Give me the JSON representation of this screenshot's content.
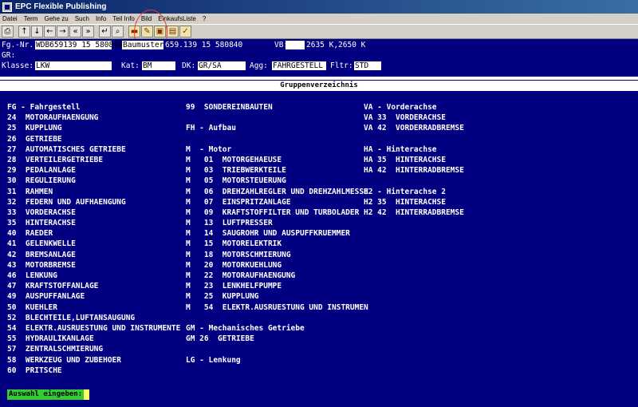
{
  "window": {
    "title": "EPC Flexible Publishing"
  },
  "menu": [
    "Datei",
    "Term",
    "Gehe zu",
    "Such",
    "Info",
    "Teil Info",
    "Bild",
    "EinkaufsListe",
    "?"
  ],
  "toolbar": {
    "icons": [
      "printer-icon",
      "arrow-up-icon",
      "arrow-down-icon",
      "arrow-left-icon",
      "arrow-right-icon",
      "double-left-icon",
      "double-right-icon",
      "return-icon",
      "search-icon",
      "car-icon",
      "tool-icon",
      "vehicle-icon",
      "truck-icon",
      "gear-icon"
    ]
  },
  "header": {
    "fg_label": "Fg.-Nr.:",
    "fg_value": "WDB659139 15 580840",
    "baumuster_label": "Baumuster:",
    "baumuster_value": "659.139 15 580840",
    "vb_label": "VB:",
    "vb_value": "2635 K,2650 K",
    "gr_label": "GR:",
    "klasse_label": "Klasse:",
    "klasse_value": "LKW",
    "kat_label": "Kat:",
    "kat_value": "BM",
    "dk_label": "DK:",
    "dk_value": "GR/SA",
    "agg_label": "Agg:",
    "agg_value": "FAHRGESTELL",
    "fltr_label": "Fltr:",
    "fltr_value": "STD"
  },
  "section_title": "Gruppenverzeichnis",
  "columns": {
    "col1": [
      "FG - Fahrgestell",
      "24  MOTORAUFHAENGUNG",
      "25  KUPPLUNG",
      "26  GETRIEBE",
      "27  AUTOMATISCHES GETRIEBE",
      "28  VERTEILERGETRIEBE",
      "29  PEDALANLAGE",
      "30  REGULIERUNG",
      "31  RAHMEN",
      "32  FEDERN UND AUFHAENGUNG",
      "33  VORDERACHSE",
      "35  HINTERACHSE",
      "40  RAEDER",
      "41  GELENKWELLE",
      "42  BREMSANLAGE",
      "43  MOTORBREMSE",
      "46  LENKUNG",
      "47  KRAFTSTOFFANLAGE",
      "49  AUSPUFFANLAGE",
      "50  KUEHLER",
      "52  BLECHTEILE,LUFTANSAUGUNG",
      "54  ELEKTR.AUSRUESTUNG UND INSTRUMENTE",
      "55  HYDRAULIKANLAGE",
      "57  ZENTRALSCHMIERUNG",
      "58  WERKZEUG UND ZUBEHOER",
      "60  PRITSCHE"
    ],
    "col2": [
      "99  SONDEREINBAUTEN",
      "",
      "FH - Aufbau",
      "",
      "M  - Motor",
      "M   01  MOTORGEHAEUSE",
      "M   03  TRIEBWERKTEILE",
      "M   05  MOTORSTEUERUNG",
      "M   06  DREHZAHLREGLER UND DREHZAHLMESSE",
      "M   07  EINSPRITZANLAGE",
      "M   09  KRAFTSTOFFILTER UND TURBOLADER",
      "M   13  LUFTPRESSER",
      "M   14  SAUGROHR UND AUSPUFFKRUEMMER",
      "M   15  MOTORELEKTRIK",
      "M   18  MOTORSCHMIERUNG",
      "M   20  MOTORKUEHLUNG",
      "M   22  MOTORAUFHAENGUNG",
      "M   23  LENKHELFPUMPE",
      "M   25  KUPPLUNG",
      "M   54  ELEKTR.AUSRUESTUNG UND INSTRUMEN",
      "",
      "GM - Mechanisches Getriebe",
      "GM 26  GETRIEBE",
      "",
      "LG - Lenkung"
    ],
    "col3": [
      "VA - Vorderachse",
      "VA 33  VORDERACHSE",
      "VA 42  VORDERRADBREMSE",
      "",
      "HA - Hinterachse",
      "HA 35  HINTERACHSE",
      "HA 42  HINTERRADBREMSE",
      "",
      "H2 - Hinterachse 2",
      "H2 35  HINTERACHSE",
      "H2 42  HINTERRADBREMSE"
    ]
  },
  "prompt": {
    "label": "Auswahl eingeben:"
  }
}
